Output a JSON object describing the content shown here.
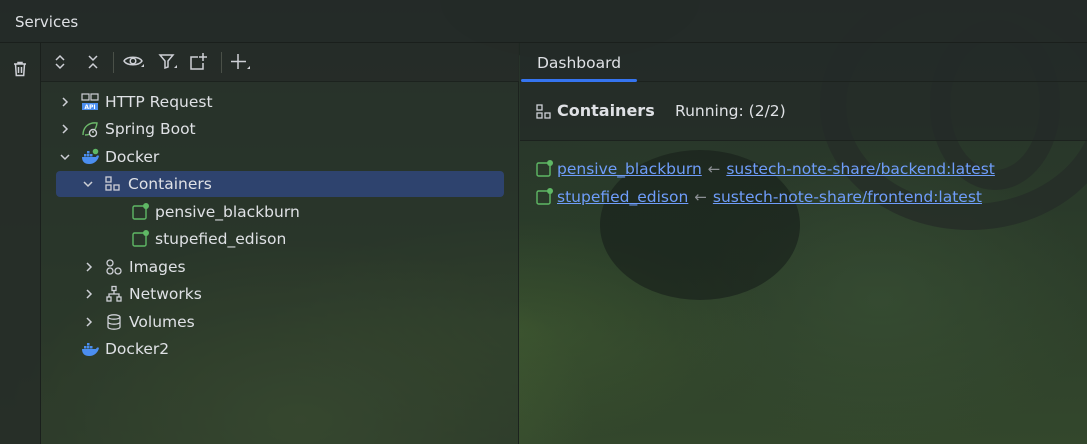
{
  "window": {
    "title": "Services"
  },
  "gutter": {
    "icons": [
      "trash-icon"
    ]
  },
  "toolbar": {
    "icons": [
      "expand-all-icon",
      "collapse-all-icon",
      "eye-icon",
      "filter-icon",
      "new-group-icon",
      "add-service-icon"
    ]
  },
  "tree": {
    "items": [
      {
        "label": "HTTP Request",
        "icon": "api-icon",
        "expanded": false
      },
      {
        "label": "Spring Boot",
        "icon": "spring-boot-icon",
        "expanded": false
      },
      {
        "label": "Docker",
        "icon": "docker-icon",
        "expanded": true
      },
      {
        "label": "Containers",
        "icon": "containers-icon",
        "expanded": true,
        "selected": true
      },
      {
        "label": "pensive_blackburn",
        "icon": "container-running-icon"
      },
      {
        "label": "stupefied_edison",
        "icon": "container-running-icon"
      },
      {
        "label": "Images",
        "icon": "images-icon",
        "expanded": false
      },
      {
        "label": "Networks",
        "icon": "networks-icon",
        "expanded": false
      },
      {
        "label": "Volumes",
        "icon": "volumes-icon",
        "expanded": false
      },
      {
        "label": "Docker2",
        "icon": "docker-icon"
      }
    ]
  },
  "dashboard": {
    "tab_label": "Dashboard",
    "header": {
      "title": "Containers",
      "running": "Running: (2/2)"
    },
    "containers": [
      {
        "name": "pensive_blackburn",
        "arrow": "←",
        "image": "sustech-note-share/backend:latest"
      },
      {
        "name": "stupefied_edison",
        "arrow": "←",
        "image": "sustech-note-share/frontend:latest"
      }
    ]
  },
  "colors": {
    "accent": "#3574f0",
    "link": "#6f9dfa",
    "selected_row": "#2e436e",
    "running_dot": "#5fb865",
    "docker_blue": "#4b8ef0"
  }
}
